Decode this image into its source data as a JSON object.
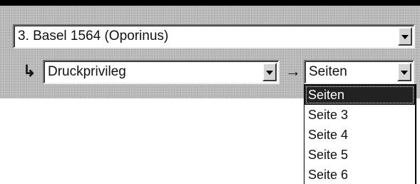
{
  "edition_select": {
    "value": "3. Basel 1564 (Oporinus)"
  },
  "section_select": {
    "arrow_icon": "return-arrow-icon",
    "value": "Druckprivileg"
  },
  "page_select": {
    "arrow_icon": "right-arrow-icon",
    "value": "Seiten",
    "options": [
      "Seiten",
      "Seite 3",
      "Seite 4",
      "Seite 5",
      "Seite 6"
    ],
    "selected_index": 0
  },
  "colors": {
    "panel_background": "#bdbdbd",
    "selection_background": "#222222",
    "selection_text": "#ffffff"
  }
}
